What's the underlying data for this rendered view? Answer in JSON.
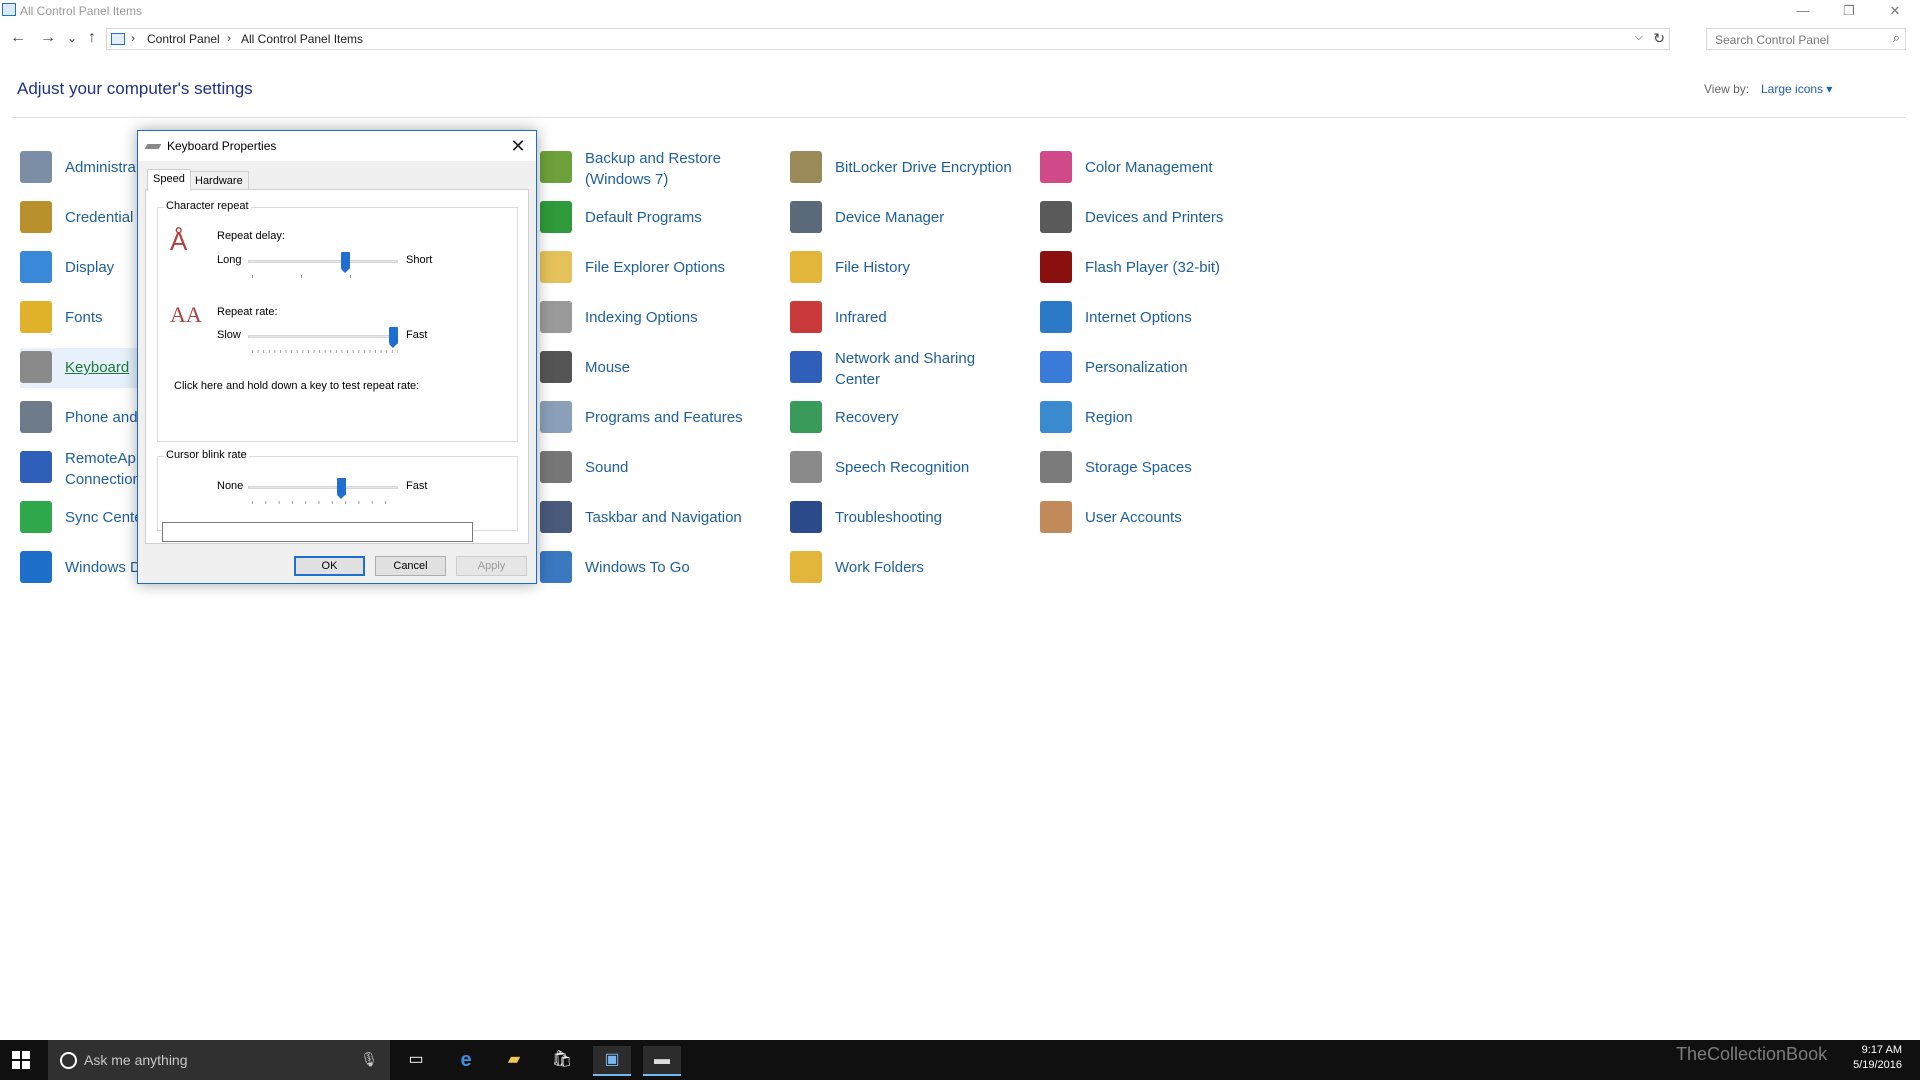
{
  "window": {
    "title": "All Control Panel Items",
    "minimize": "—",
    "restore": "❐",
    "close": "✕"
  },
  "nav": {
    "back": "←",
    "forward": "→",
    "recent": "⌄",
    "up": "↑"
  },
  "address": {
    "crumbs": [
      "Control Panel",
      "All Control Panel Items"
    ],
    "sep": "›",
    "dropdown": "⌵",
    "refresh": "↻"
  },
  "search": {
    "placeholder": "Search Control Panel",
    "icon": "⌕"
  },
  "header": {
    "title": "Adjust your computer's settings",
    "view_by_label": "View by:",
    "view_by_value": "Large icons ▾"
  },
  "items": [
    {
      "label": "Administra",
      "icon": "admin-tools-icon",
      "color": "#7b8ea6"
    },
    {
      "label": "Credential",
      "icon": "credential-icon",
      "color": "#b8902c"
    },
    {
      "label": "Display",
      "icon": "display-icon",
      "color": "#3a88d8"
    },
    {
      "label": "Fonts",
      "icon": "fonts-icon",
      "color": "#e0b12a"
    },
    {
      "label": "Keyboard",
      "icon": "keyboard-icon",
      "color": "#8a8a8a"
    },
    {
      "label": "Phone and",
      "icon": "phone-icon",
      "color": "#6d7b8a"
    },
    {
      "label": "RemoteAp",
      "label2": "Connection",
      "icon": "remoteapp-icon",
      "color": "#2f5fb8"
    },
    {
      "label": "Sync Cente",
      "icon": "sync-icon",
      "color": "#2ea84a"
    },
    {
      "label": "Windows D",
      "icon": "defender-icon",
      "color": "#1d6fc9"
    },
    {
      "label": "Backup and Restore",
      "label2": "(Windows 7)",
      "icon": "backup-icon",
      "color": "#6ca03a"
    },
    {
      "label": "Default Programs",
      "icon": "default-programs-icon",
      "color": "#2f9a3a"
    },
    {
      "label": "File Explorer Options",
      "icon": "file-explorer-options-icon",
      "color": "#e4c15a"
    },
    {
      "label": "Indexing Options",
      "icon": "indexing-icon",
      "color": "#9a9a9a"
    },
    {
      "label": "Mouse",
      "icon": "mouse-icon",
      "color": "#555555"
    },
    {
      "label": "Programs and Features",
      "icon": "programs-icon",
      "color": "#8aa0b8"
    },
    {
      "label": "Sound",
      "icon": "sound-icon",
      "color": "#777777"
    },
    {
      "label": "Taskbar and Navigation",
      "icon": "taskbar-icon",
      "color": "#4a5a7a"
    },
    {
      "label": "Windows To Go",
      "icon": "windows-to-go-icon",
      "color": "#3a78c0"
    },
    {
      "label": "BitLocker Drive Encryption",
      "icon": "bitlocker-icon",
      "color": "#9a8a5a"
    },
    {
      "label": "Device Manager",
      "icon": "device-manager-icon",
      "color": "#5a6a7a"
    },
    {
      "label": "File History",
      "icon": "file-history-icon",
      "color": "#e2b63a"
    },
    {
      "label": "Infrared",
      "icon": "infrared-icon",
      "color": "#c83a3a"
    },
    {
      "label": "Network and Sharing",
      "label2": "Center",
      "icon": "network-icon",
      "color": "#2f5fb8"
    },
    {
      "label": "Recovery",
      "icon": "recovery-icon",
      "color": "#3a9a5a"
    },
    {
      "label": "Speech Recognition",
      "icon": "microphone-icon",
      "color": "#8a8a8a"
    },
    {
      "label": "Troubleshooting",
      "icon": "troubleshooting-icon",
      "color": "#2a4a8a"
    },
    {
      "label": "Work Folders",
      "icon": "work-folders-icon",
      "color": "#e2b63a"
    },
    {
      "label": "Color Management",
      "icon": "color-management-icon",
      "color": "#d04a8a"
    },
    {
      "label": "Devices and Printers",
      "icon": "printer-icon",
      "color": "#5a5a5a"
    },
    {
      "label": "Flash Player (32-bit)",
      "icon": "flash-player-icon",
      "color": "#8a1010"
    },
    {
      "label": "Internet Options",
      "icon": "internet-options-icon",
      "color": "#2a7ac8"
    },
    {
      "label": "Personalization",
      "icon": "personalization-icon",
      "color": "#3a7ad8"
    },
    {
      "label": "Region",
      "icon": "region-icon",
      "color": "#3a8ad0"
    },
    {
      "label": "Storage Spaces",
      "icon": "storage-spaces-icon",
      "color": "#7a7a7a"
    },
    {
      "label": "User Accounts",
      "icon": "user-accounts-icon",
      "color": "#c08a5a"
    }
  ],
  "dialog": {
    "title": "Keyboard Properties",
    "close": "✕",
    "tabs": [
      "Speed",
      "Hardware"
    ],
    "char_repeat": "Character repeat",
    "repeat_delay": "Repeat delay:",
    "long": "Long",
    "short": "Short",
    "repeat_delay_level": 0.66,
    "repeat_rate": "Repeat rate:",
    "slow": "Slow",
    "fast": "Fast",
    "repeat_rate_level": 1.0,
    "test_prompt": "Click here and hold down a key to test repeat rate:",
    "test_value": "",
    "cursor_blink": "Cursor blink rate",
    "none": "None",
    "fast2": "Fast",
    "cursor_blink_level": 0.63,
    "ok": "OK",
    "cancel": "Cancel",
    "apply": "Apply"
  },
  "taskbar": {
    "search_placeholder": "Ask me anything",
    "mic": "🎙",
    "time": "9:17 AM",
    "date": "5/19/2016",
    "watermark": "TheCollectionBook"
  }
}
